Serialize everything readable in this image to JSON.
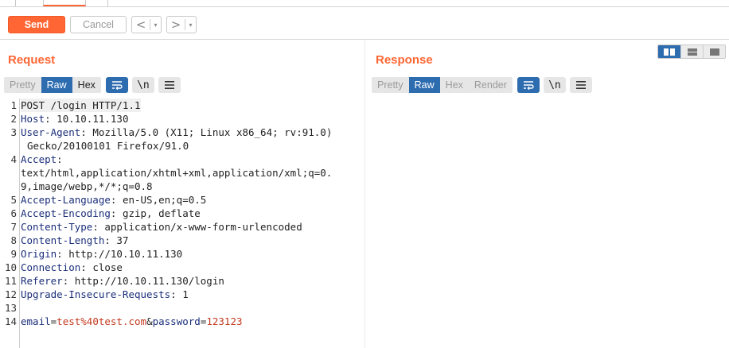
{
  "toolbar": {
    "send_label": "Send",
    "cancel_label": "Cancel",
    "back_glyph": "<",
    "forward_glyph": ">",
    "dropdown_glyph": "▾"
  },
  "request": {
    "title": "Request",
    "view_tabs": [
      "Pretty",
      "Raw",
      "Hex"
    ],
    "active_tab": "Raw",
    "newline_label": "\\n",
    "lines": [
      {
        "n": "1",
        "text": "POST /login HTTP/1.1"
      },
      {
        "n": "2",
        "name": "Host",
        "value": " 10.10.11.130"
      },
      {
        "n": "3",
        "name": "User-Agent",
        "value": " Mozilla/5.0 (X11; Linux x86_64; rv:91.0)",
        "cont": "Gecko/20100101 Firefox/91.0"
      },
      {
        "n": "4",
        "name": "Accept",
        "value": "",
        "cont1": "text/html,application/xhtml+xml,application/xml;q=0.",
        "cont2": "9,image/webp,*/*;q=0.8"
      },
      {
        "n": "5",
        "name": "Accept-Language",
        "value": " en-US,en;q=0.5"
      },
      {
        "n": "6",
        "name": "Accept-Encoding",
        "value": " gzip, deflate"
      },
      {
        "n": "7",
        "name": "Content-Type",
        "value": " application/x-www-form-urlencoded"
      },
      {
        "n": "8",
        "name": "Content-Length",
        "value": " 37"
      },
      {
        "n": "9",
        "name": "Origin",
        "value": " http://10.10.11.130"
      },
      {
        "n": "10",
        "name": "Connection",
        "value": " close"
      },
      {
        "n": "11",
        "name": "Referer",
        "value": " http://10.10.11.130/login"
      },
      {
        "n": "12",
        "name": "Upgrade-Insecure-Requests",
        "value": " 1"
      },
      {
        "n": "13",
        "text": ""
      },
      {
        "n": "14",
        "body": {
          "p1": "email",
          "v1": "test%40test.com",
          "amp": "&",
          "p2": "password",
          "v2": "123123",
          "eq": "="
        }
      }
    ]
  },
  "response": {
    "title": "Response",
    "view_tabs": [
      "Pretty",
      "Raw",
      "Hex",
      "Render"
    ],
    "active_tab": "Raw",
    "newline_label": "\\n"
  },
  "colors": {
    "accent": "#ff6633",
    "selected_blue": "#2e6cb0",
    "header_name": "#1a2e7a",
    "param_value": "#c33a20"
  }
}
